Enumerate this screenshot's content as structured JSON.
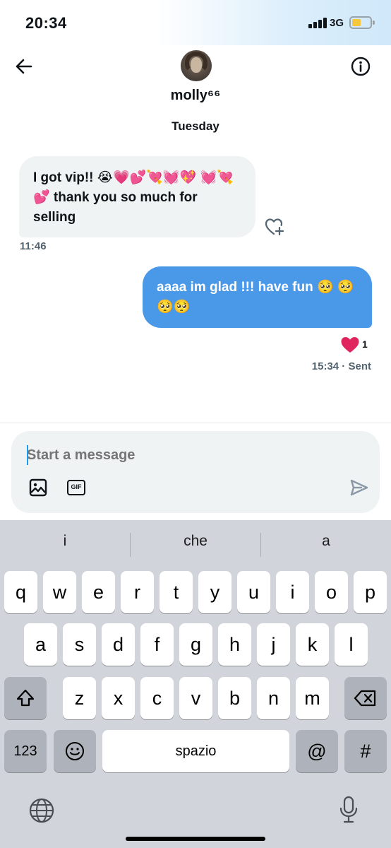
{
  "status_bar": {
    "time": "20:34",
    "network": "3G"
  },
  "header": {
    "username": "molly⁶⁶",
    "day_label": "Tuesday"
  },
  "messages": [
    {
      "direction": "incoming",
      "text": "I got vip!! 😭💗💕💘💓💖 💓💘💕 thank you so much for selling",
      "time": "11:46"
    },
    {
      "direction": "outgoing",
      "text": "aaaa im glad !!! have fun 🥺 🥺🥺🥺",
      "time": "15:34",
      "status": "Sent",
      "reaction": "❤️",
      "reaction_count": "1"
    }
  ],
  "composer": {
    "placeholder": "Start a message",
    "gif_label": "GIF"
  },
  "keyboard": {
    "suggestions": [
      "i",
      "che",
      "a"
    ],
    "row1": [
      "q",
      "w",
      "e",
      "r",
      "t",
      "y",
      "u",
      "i",
      "o",
      "p"
    ],
    "row2": [
      "a",
      "s",
      "d",
      "f",
      "g",
      "h",
      "j",
      "k",
      "l"
    ],
    "row3": [
      "z",
      "x",
      "c",
      "v",
      "b",
      "n",
      "m"
    ],
    "numbers_label": "123",
    "space_label": "spazio",
    "at_label": "@",
    "hash_label": "#"
  },
  "colors": {
    "accent": "#4a98e8",
    "bubble_in": "#eff3f4",
    "keyboard_bg": "#d1d4da",
    "heart": "#e0245e"
  },
  "icons": [
    "back-arrow-icon",
    "info-icon",
    "heart-plus-icon",
    "heart-icon",
    "image-icon",
    "gif-icon",
    "send-icon",
    "shift-icon",
    "backspace-icon",
    "emoji-icon",
    "globe-icon",
    "microphone-icon"
  ]
}
